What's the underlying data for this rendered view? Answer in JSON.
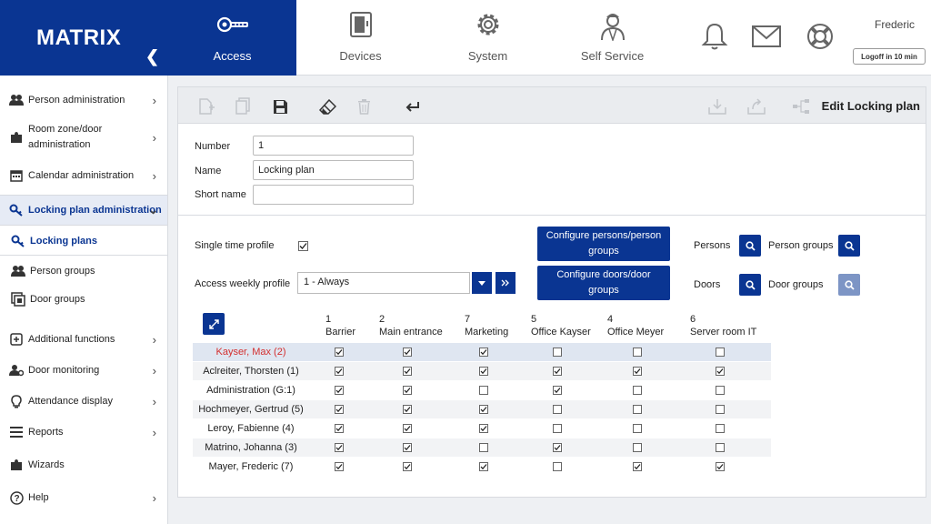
{
  "app": {
    "name": "MATRIX"
  },
  "topnav": {
    "tabs": [
      {
        "label": "Access",
        "icon": "key-icon",
        "active": true
      },
      {
        "label": "Devices",
        "icon": "device-icon",
        "active": false
      },
      {
        "label": "System",
        "icon": "gear-icon",
        "active": false
      },
      {
        "label": "Self Service",
        "icon": "user-icon",
        "active": false
      }
    ]
  },
  "user": {
    "name": "Frederic",
    "logoff_label": "Logoff in 10 min"
  },
  "sidebar": {
    "items": [
      {
        "label": "Person administration",
        "icon": "people-icon"
      },
      {
        "label": "Room zone/door administration",
        "icon": "puzzle-icon"
      },
      {
        "label": "Calendar administration",
        "icon": "calendar-icon"
      },
      {
        "label": "Locking plan administration",
        "icon": "key-icon"
      },
      {
        "label": "Locking plans",
        "icon": "key-icon"
      },
      {
        "label": "Person groups",
        "icon": "people-icon"
      },
      {
        "label": "Door groups",
        "icon": "door-group-icon"
      },
      {
        "label": "Additional functions",
        "icon": "plus-box-icon"
      },
      {
        "label": "Door monitoring",
        "icon": "person-gear-icon"
      },
      {
        "label": "Attendance display",
        "icon": "bulb-icon"
      },
      {
        "label": "Reports",
        "icon": "list-icon"
      },
      {
        "label": "Wizards",
        "icon": "puzzle-icon"
      },
      {
        "label": "Help",
        "icon": "help-icon"
      }
    ]
  },
  "panel": {
    "title": "Edit Locking plan"
  },
  "form": {
    "number_label": "Number",
    "number_value": "1",
    "name_label": "Name",
    "name_value": "Locking plan",
    "short_name_label": "Short name",
    "short_name_value": "",
    "single_time_profile_label": "Single time profile",
    "single_time_profile_checked": true,
    "weekly_profile_label": "Access weekly profile",
    "weekly_profile_value": "1 - Always"
  },
  "buttons": {
    "configure_persons": "Configure persons/person groups",
    "configure_doors": "Configure doors/door groups"
  },
  "filters": {
    "persons_label": "Persons",
    "person_groups_label": "Person groups",
    "doors_label": "Doors",
    "door_groups_label": "Door groups"
  },
  "matrix": {
    "columns": [
      {
        "num": "1",
        "name": "Barrier"
      },
      {
        "num": "2",
        "name": "Main entrance"
      },
      {
        "num": "7",
        "name": "Marketing"
      },
      {
        "num": "5",
        "name": "Office Kayser"
      },
      {
        "num": "4",
        "name": "Office Meyer"
      },
      {
        "num": "6",
        "name": "Server room IT"
      }
    ],
    "rows": [
      {
        "name": "Kayser, Max (2)",
        "highlight": true,
        "checks": [
          true,
          true,
          true,
          false,
          false,
          false
        ]
      },
      {
        "name": "Aclreiter, Thorsten (1)",
        "highlight": false,
        "checks": [
          true,
          true,
          true,
          true,
          true,
          true
        ]
      },
      {
        "name": "Administration (G:1)",
        "highlight": false,
        "checks": [
          true,
          true,
          false,
          true,
          false,
          false
        ]
      },
      {
        "name": "Hochmeyer, Gertrud (5)",
        "highlight": false,
        "checks": [
          true,
          true,
          true,
          false,
          false,
          false
        ]
      },
      {
        "name": "Leroy, Fabienne (4)",
        "highlight": false,
        "checks": [
          true,
          true,
          true,
          false,
          false,
          false
        ]
      },
      {
        "name": "Matrino, Johanna (3)",
        "highlight": false,
        "checks": [
          true,
          true,
          false,
          true,
          false,
          false
        ]
      },
      {
        "name": "Mayer, Frederic (7)",
        "highlight": false,
        "checks": [
          true,
          true,
          true,
          false,
          true,
          true
        ]
      }
    ]
  },
  "colors": {
    "brand": "#0a3592",
    "highlight_name": "#d32f2f",
    "highlight_row": "#dfe6f1",
    "alt_row": "#f2f3f5"
  }
}
